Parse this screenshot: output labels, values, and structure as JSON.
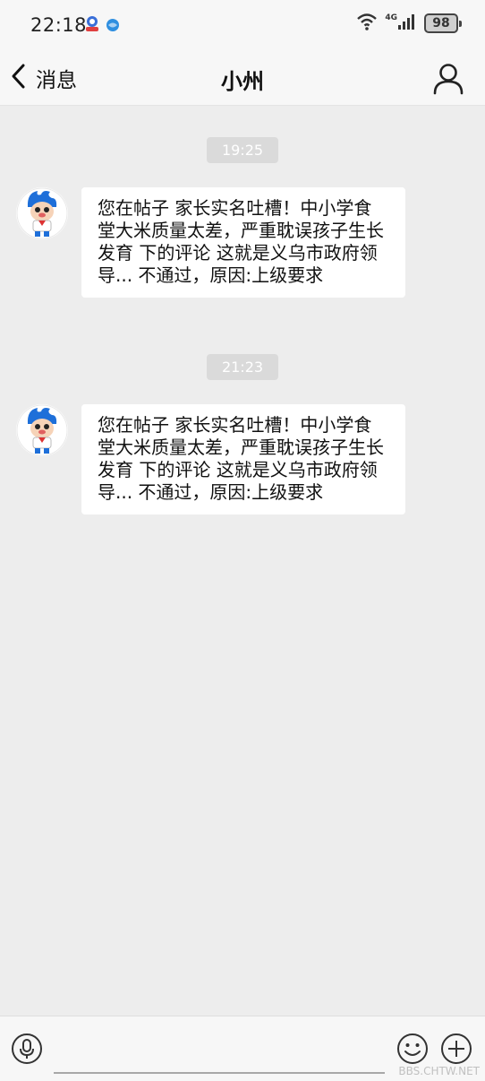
{
  "status_bar": {
    "time": "22:18",
    "network": "4G",
    "battery": "98"
  },
  "header": {
    "back_label": "消息",
    "title": "小州"
  },
  "messages": [
    {
      "time": "19:25",
      "text": "您在帖子 家长实名吐槽！中小学食堂大米质量太差，严重耽误孩子生长发育 下的评论 这就是义乌市政府领导... 不通过，原因:上级要求"
    },
    {
      "time": "21:23",
      "text": "您在帖子 家长实名吐槽！中小学食堂大米质量太差，严重耽误孩子生长发育 下的评论 这就是义乌市政府领导... 不通过，原因:上级要求"
    }
  ],
  "input_bar": {
    "placeholder": ""
  },
  "watermark": "BBS.CHTW.NET",
  "icons": [
    "notification-app-icon",
    "browser-app-icon",
    "wifi-icon",
    "signal-icon",
    "battery-icon",
    "back-chevron-icon",
    "profile-icon",
    "avatar-mascot-icon",
    "microphone-icon",
    "emoji-icon",
    "plus-icon"
  ]
}
